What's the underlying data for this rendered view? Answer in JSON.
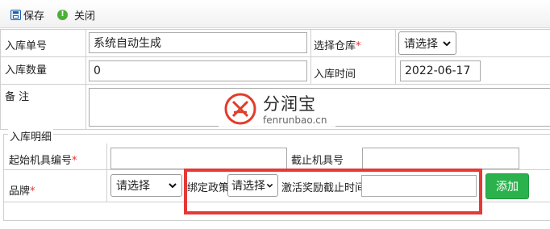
{
  "toolbar": {
    "save_label": "保存",
    "close_label": "关闭"
  },
  "form": {
    "receipt_no_label": "入库单号",
    "receipt_no_value": "系统自动生成",
    "warehouse_label": "选择仓库",
    "warehouse_required": "*",
    "warehouse_select": "请选择",
    "quantity_label": "入库数量",
    "quantity_value": "0",
    "time_label": "入库时间",
    "time_value": "2022-06-17",
    "remark_label": "备 注",
    "remark_value": ""
  },
  "details": {
    "legend": "入库明细",
    "start_no_label": "起始机具编号",
    "start_no_required": "*",
    "start_no_value": "",
    "end_no_label": "截止机具号",
    "end_no_value": "",
    "brand_label": "品牌",
    "brand_required": "*",
    "brand_select": "请选择",
    "policy_label": "绑定政策",
    "policy_select": "请选择",
    "reward_deadline_label": "激活奖励截止时间",
    "reward_deadline_value": "",
    "add_label": "添加"
  },
  "watermark": {
    "name": "分润宝",
    "url": "fenrunbao.cn"
  },
  "colors": {
    "highlight": "#e53935",
    "add_button": "#2bb24c",
    "required": "#d33333"
  }
}
